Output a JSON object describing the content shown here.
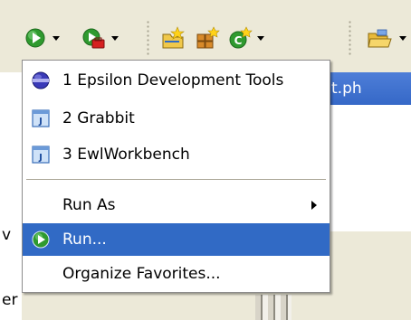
{
  "colors": {
    "menu_bg": "#ffffff",
    "selection": "#316ac5",
    "toolbar_bg": "#ece9d8",
    "run_green": "#2f9a2f",
    "tab_blue": "#3568c7"
  },
  "toolbar": {
    "buttons": [
      {
        "icon": "run-icon"
      },
      {
        "icon": "run-configuration-icon"
      },
      {
        "icon": "new-project-icon"
      },
      {
        "icon": "new-package-icon"
      },
      {
        "icon": "new-class-icon"
      },
      {
        "icon": "open-folder-icon"
      }
    ]
  },
  "background": {
    "tab_text": "t.ph",
    "fragment_v": "v",
    "fragment_er": "er"
  },
  "menu": {
    "items": [
      {
        "label": "1 Epsilon Development Tools",
        "icon": "epsilon-launch-icon"
      },
      {
        "label": "2 Grabbit",
        "icon": "java-launch-icon"
      },
      {
        "label": "3 EwlWorkbench",
        "icon": "java-launch-icon"
      },
      {
        "label": "Run As",
        "icon": "chevron-right-icon"
      },
      {
        "label": "Run...",
        "icon": "run-icon",
        "selected": true
      },
      {
        "label": "Organize Favorites...",
        "icon": ""
      }
    ]
  }
}
